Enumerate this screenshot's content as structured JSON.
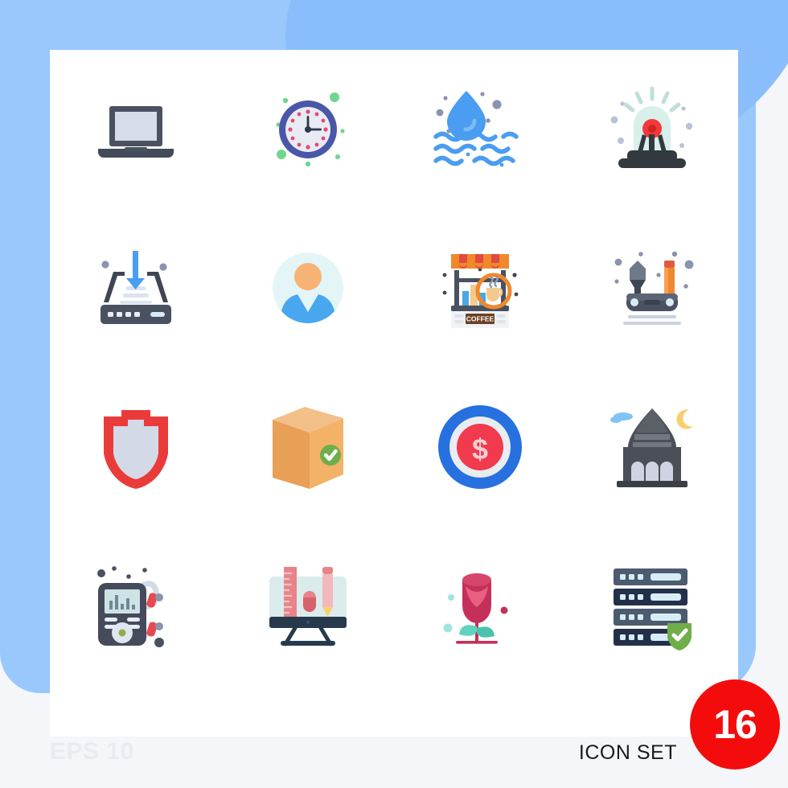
{
  "artboard": {
    "background_color": "#99c8fd",
    "card_color": "#ffffff"
  },
  "footer": {
    "eps_label": "EPS 10",
    "icon_set_label": "ICON SET",
    "badge_count": "16",
    "badge_color": "#f40c0c"
  },
  "grid": {
    "columns": 4,
    "rows": 4,
    "icons": [
      {
        "name": "laptop-icon",
        "label": "Laptop",
        "row": 1,
        "col": 1,
        "colors": [
          "#4a5160",
          "#d6dcea"
        ]
      },
      {
        "name": "clock-icon",
        "label": "Clock",
        "row": 1,
        "col": 2,
        "colors": [
          "#4a57a8",
          "#e6e9f0",
          "#e8467c",
          "#5fd68f"
        ]
      },
      {
        "name": "water-drop-waves-icon",
        "label": "Water",
        "row": 1,
        "col": 3,
        "colors": [
          "#4a9df0",
          "#8b93ad"
        ]
      },
      {
        "name": "siren-alarm-icon",
        "label": "Siren",
        "row": 1,
        "col": 4,
        "colors": [
          "#333a3f",
          "#f23a3a",
          "#d6ece8"
        ]
      },
      {
        "name": "scanner-download-icon",
        "label": "Scanner Download",
        "row": 2,
        "col": 1,
        "colors": [
          "#3f4654",
          "#4a9df0",
          "#dde2ee"
        ]
      },
      {
        "name": "user-avatar-icon",
        "label": "User",
        "row": 2,
        "col": 2,
        "colors": [
          "#e4f5f8",
          "#f7b373",
          "#49a7ef"
        ]
      },
      {
        "name": "coffee-shop-icon",
        "label": "Coffee Shop",
        "row": 2,
        "col": 3,
        "colors": [
          "#f0882c",
          "#e04b3e",
          "#6c4024"
        ],
        "text": "COFFEE"
      },
      {
        "name": "design-tools-icon",
        "label": "Design Tools",
        "row": 2,
        "col": 4,
        "colors": [
          "#4a5160",
          "#f0882c",
          "#c8d2e0"
        ]
      },
      {
        "name": "shield-icon",
        "label": "Shield",
        "row": 3,
        "col": 1,
        "colors": [
          "#ea3b3b",
          "#d4d9e8"
        ]
      },
      {
        "name": "package-verified-icon",
        "label": "Verified Package",
        "row": 3,
        "col": 2,
        "colors": [
          "#f3b268",
          "#e8a057",
          "#6fae4a"
        ]
      },
      {
        "name": "dollar-target-icon",
        "label": "Money Target",
        "row": 3,
        "col": 3,
        "colors": [
          "#2770e0",
          "#f23a4e",
          "#e8edf2"
        ]
      },
      {
        "name": "mosque-icon",
        "label": "Mosque",
        "row": 3,
        "col": 4,
        "colors": [
          "#4b4f57",
          "#cfd4e2",
          "#f7cf6e",
          "#7fc4f2"
        ]
      },
      {
        "name": "mp3-player-icon",
        "label": "MP3 Player",
        "row": 4,
        "col": 1,
        "colors": [
          "#454b5a",
          "#e8494e",
          "#cfd8e5"
        ]
      },
      {
        "name": "monitor-design-icon",
        "label": "Graphic Design",
        "row": 4,
        "col": 2,
        "colors": [
          "#27394d",
          "#e8838a",
          "#dcebeb"
        ]
      },
      {
        "name": "rose-flower-icon",
        "label": "Rose",
        "row": 4,
        "col": 3,
        "colors": [
          "#c5305a",
          "#5fd3bd"
        ]
      },
      {
        "name": "secure-server-icon",
        "label": "Secure Server",
        "row": 4,
        "col": 4,
        "colors": [
          "#4d5b70",
          "#22304a",
          "#6fae4a"
        ]
      }
    ]
  }
}
